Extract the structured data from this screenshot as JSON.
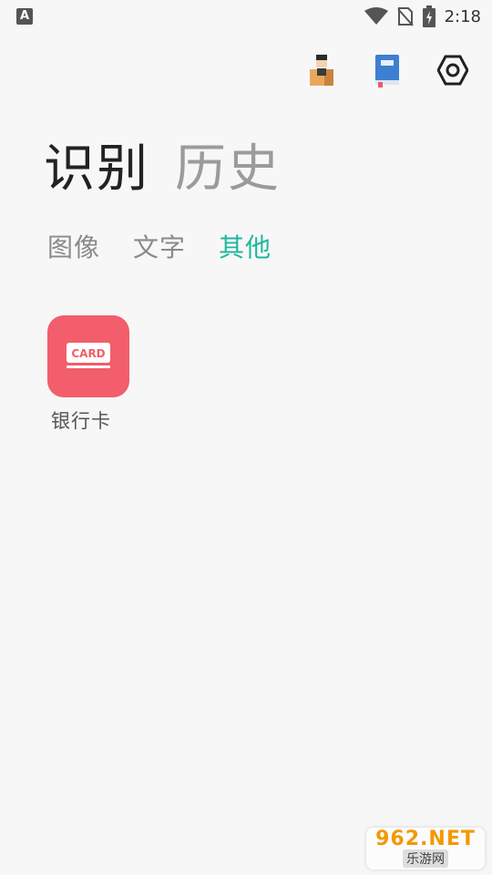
{
  "status": {
    "left_badge": "A",
    "time": "2:18",
    "icons": [
      "wifi-icon",
      "no-sim-icon",
      "battery-charging-icon"
    ]
  },
  "toolbar": {
    "icons": [
      "person-box-icon",
      "book-icon",
      "settings-icon"
    ]
  },
  "main_tabs": [
    {
      "label": "识别",
      "active": true
    },
    {
      "label": "历史",
      "active": false
    }
  ],
  "sub_tabs": [
    {
      "label": "图像",
      "active": false
    },
    {
      "label": "文字",
      "active": false
    },
    {
      "label": "其他",
      "active": true
    }
  ],
  "items": [
    {
      "label": "银行卡",
      "icon": "card-icon",
      "icon_text": "CARD",
      "color": "#f25e6b"
    }
  ],
  "colors": {
    "accent": "#1fb7a0",
    "card": "#f25e6b"
  },
  "watermark": {
    "top": "962.NET",
    "bottom": "乐游网"
  }
}
